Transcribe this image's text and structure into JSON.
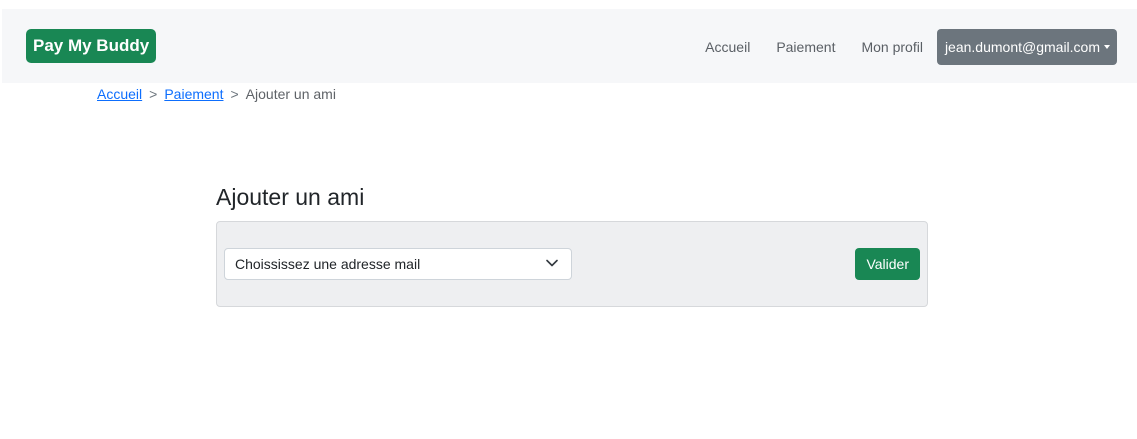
{
  "navbar": {
    "brand": "Pay My Buddy",
    "links": [
      "Accueil",
      "Paiement",
      "Mon profil"
    ],
    "user_email": "jean.dumont@gmail.com"
  },
  "breadcrumb": {
    "items": [
      "Accueil",
      "Paiement"
    ],
    "separator": ">",
    "current": "Ajouter un ami"
  },
  "main": {
    "title": "Ajouter un ami",
    "select_value": "Choississez une adresse mail",
    "submit_label": "Valider"
  },
  "colors": {
    "brand": "#198754",
    "navbar_bg": "#f6f7f9",
    "dropdown_bg": "#6c757d",
    "link": "#0d6efd",
    "card_bg": "#eeeff1"
  },
  "icons": {
    "dropdown_caret": "caret-down-icon",
    "select_chevron": "chevron-down-icon"
  }
}
